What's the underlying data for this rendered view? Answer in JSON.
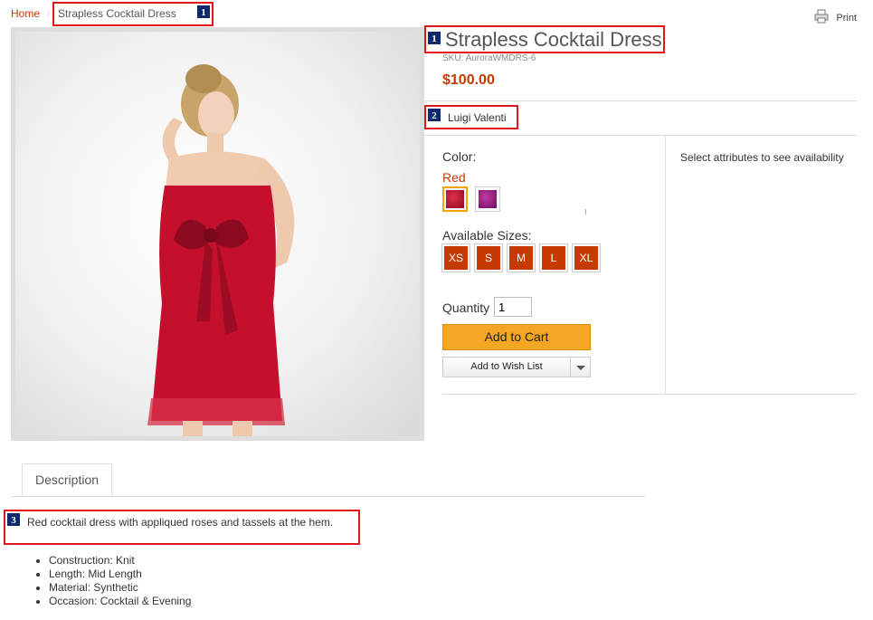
{
  "breadcrumb": {
    "home": "Home",
    "separator": "/",
    "current": "Strapless Cocktail Dress"
  },
  "toolbar": {
    "print_label": "Print"
  },
  "markers": [
    "1",
    "1",
    "2",
    "3"
  ],
  "product": {
    "title": "Strapless Cocktail Dress",
    "sku": "SKU: AuroraWMDRS-6",
    "price": "$100.00",
    "brand": "Luigi Valenti"
  },
  "attributes": {
    "color_label": "Color:",
    "color_selected": "Red",
    "swatches": [
      {
        "name": "Red",
        "color": "#b5102a"
      },
      {
        "name": "Purple",
        "color": "#9a1a7e"
      }
    ],
    "sizes_label": "Available Sizes:",
    "sizes": [
      "XS",
      "S",
      "M",
      "L",
      "XL"
    ]
  },
  "purchase": {
    "quantity_label": "Quantity",
    "quantity_value": "1",
    "add_to_cart": "Add to Cart",
    "add_to_wishlist": "Add to Wish List"
  },
  "availability": {
    "message": "Select attributes to see availability"
  },
  "tabs": {
    "description": "Description"
  },
  "description": {
    "summary": "Red cocktail dress with appliqued roses and tassels at the hem.",
    "features": [
      "Construction: Knit",
      "Length: Mid Length",
      "Material: Synthetic",
      "Occasion: Cocktail & Evening"
    ]
  },
  "colors": {
    "accent": "#c63a00",
    "cart_button": "#f5a623",
    "annotation": "#e0161b",
    "marker": "#0d2a6e"
  }
}
